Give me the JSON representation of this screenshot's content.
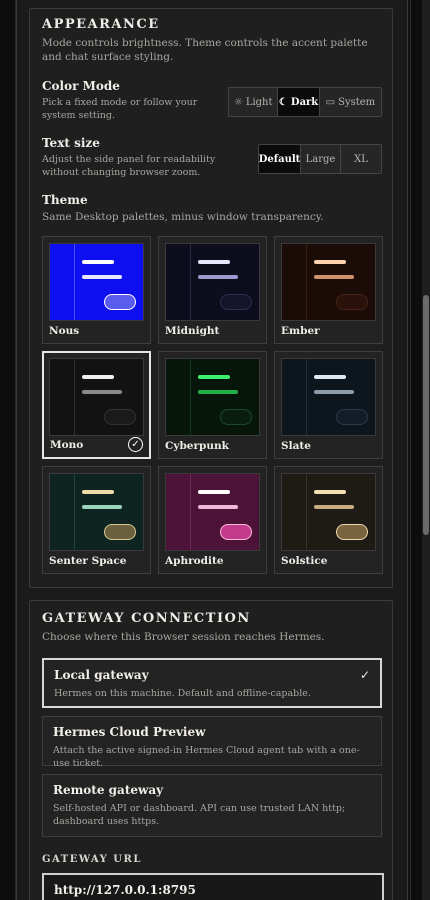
{
  "appearance": {
    "title": "APPEARANCE",
    "description": "Mode controls brightness. Theme controls the accent palette and chat surface styling.",
    "color_mode": {
      "label": "Color Mode",
      "description": "Pick a fixed mode or follow your system setting.",
      "options": [
        {
          "label": "Light",
          "icon": "sun-icon",
          "glyph": "☼"
        },
        {
          "label": "Dark",
          "icon": "moon-icon",
          "glyph": "☾"
        },
        {
          "label": "System",
          "icon": "monitor-icon",
          "glyph": "▭"
        }
      ],
      "selected": "Dark"
    },
    "text_size": {
      "label": "Text size",
      "description": "Adjust the side panel for readability without changing browser zoom.",
      "options": [
        "Default",
        "Large",
        "XL"
      ],
      "selected": "Default"
    },
    "theme": {
      "label": "Theme",
      "description": "Same Desktop palettes, minus window transparency.",
      "selected": "Mono",
      "check_glyph": "✓",
      "themes": [
        {
          "name": "Nous",
          "bg": "#0d0ff0",
          "div": "#4a4cff",
          "line1": "#ffffff",
          "line2": "#e6e6ff",
          "pill_bg": "#5a5cf0",
          "pill_border": "#ffffff"
        },
        {
          "name": "Midnight",
          "bg": "#0d0d1e",
          "div": "#2a2a44",
          "line1": "#e6e6ff",
          "line2": "#9b9bcf",
          "pill_bg": "#14142a",
          "pill_border": "#2e2e50"
        },
        {
          "name": "Ember",
          "bg": "#1c0c07",
          "div": "#3b1d12",
          "line1": "#ffd2b0",
          "line2": "#d09070",
          "pill_bg": "#2a120a",
          "pill_border": "#4a2216"
        },
        {
          "name": "Mono",
          "bg": "#121212",
          "div": "#303030",
          "line1": "#f0f0f0",
          "line2": "#8a8a8a",
          "pill_bg": "#1a1a1a",
          "pill_border": "#333333"
        },
        {
          "name": "Cyberpunk",
          "bg": "#06160b",
          "div": "#12381f",
          "line1": "#3cf06a",
          "line2": "#1fb04a",
          "pill_bg": "#0a1e10",
          "pill_border": "#1c4a2a"
        },
        {
          "name": "Slate",
          "bg": "#0d151d",
          "div": "#22303c",
          "line1": "#e0e8f0",
          "line2": "#8a9aa8",
          "pill_bg": "#131d27",
          "pill_border": "#2a3a48"
        },
        {
          "name": "Senter Space",
          "bg": "#0e2420",
          "div": "#24443c",
          "line1": "#f0dca8",
          "line2": "#9ed4bc",
          "pill_bg": "#6a6040",
          "pill_border": "#d8c890"
        },
        {
          "name": "Aphrodite",
          "bg": "#4c1238",
          "div": "#6e2a58",
          "line1": "#ffffff",
          "line2": "#f2b8d8",
          "pill_bg": "#c23a8a",
          "pill_border": "#ffb8e0"
        },
        {
          "name": "Solstice",
          "bg": "#1e1a14",
          "div": "#3a3428",
          "line1": "#f4e0b4",
          "line2": "#c8ac80",
          "pill_bg": "#7a6440",
          "pill_border": "#ecd8a8"
        }
      ]
    }
  },
  "gateway": {
    "title": "GATEWAY CONNECTION",
    "description": "Choose where this Browser session reaches Hermes.",
    "options": [
      {
        "title": "Local gateway",
        "description": "Hermes on this machine. Default and offline-capable.",
        "selected": true
      },
      {
        "title": "Hermes Cloud Preview",
        "description": "Attach the active signed-in Hermes Cloud agent tab with a one-use ticket.",
        "selected": false
      },
      {
        "title": "Remote gateway",
        "description": "Self-hosted API or dashboard. API can use trusted LAN http; dashboard uses https.",
        "selected": false
      }
    ],
    "check_glyph": "✓",
    "url_label": "GATEWAY URL",
    "url_value": "http://127.0.0.1:8795"
  }
}
